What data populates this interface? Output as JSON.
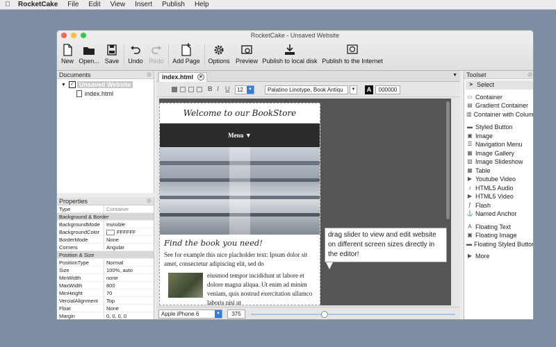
{
  "menubar": {
    "app": "RocketCake",
    "items": [
      "File",
      "Edit",
      "View",
      "Insert",
      "Publish",
      "Help"
    ]
  },
  "window": {
    "title": "RocketCake - Unsaved Website"
  },
  "toolbar": {
    "new": "New",
    "open": "Open...",
    "save": "Save",
    "undo": "Undo",
    "redo": "Redo",
    "add_page": "Add Page",
    "options": "Options",
    "preview": "Preview",
    "publish_local": "Publish to local disk",
    "publish_internet": "Publish to the Internet"
  },
  "documents": {
    "title": "Documents",
    "root": "Unsaved Website",
    "file": "index.html"
  },
  "properties": {
    "title": "Properties",
    "header": {
      "k": "Type",
      "v": "Container"
    },
    "rows": [
      {
        "k": "Background & Border",
        "v": "",
        "group": true
      },
      {
        "k": "BackgroundMode",
        "v": "Invisible"
      },
      {
        "k": "BackgroundColor",
        "v": "FFFFFF"
      },
      {
        "k": "BorderMode",
        "v": "None"
      },
      {
        "k": "Corners",
        "v": "Angular"
      },
      {
        "k": "Position & Size",
        "v": "",
        "group": true
      },
      {
        "k": "PositionType",
        "v": "Normal"
      },
      {
        "k": "Size",
        "v": "100%, auto"
      },
      {
        "k": "MinWidth",
        "v": "none"
      },
      {
        "k": "MaxWidth",
        "v": "800"
      },
      {
        "k": "MinHeight",
        "v": "70"
      },
      {
        "k": "VercialAlignment",
        "v": "Top"
      },
      {
        "k": "Float",
        "v": "None"
      },
      {
        "k": "Margin",
        "v": "0, 0, 0, 0"
      }
    ]
  },
  "editor": {
    "tab": "index.html",
    "font_size": "12",
    "font_name": "Palatino Linotype, Book Antiqu",
    "color_label": "A",
    "color_value": "000000",
    "device": "Apple iPhone 6",
    "width_value": "375",
    "slider_fraction": 0.36
  },
  "page": {
    "heading": "Welcome to our BookStore",
    "menu": "Menu",
    "find_title": "Find the book you need!",
    "p1": "See for example this nice placholder text: Ipsum dolor sit amet, consectetur adipiscing elit, sed do",
    "p2": "eiusmod tempor incididunt ut labore et dolore magna aliqua. Ut enim ad minim veniam, quis nostrud exercitation ullamco laboris nisi ut"
  },
  "tooltip": {
    "text": "drag slider to view and edit website on different screen sizes directly in the editor!"
  },
  "toolset": {
    "title": "Toolset",
    "select": "Select",
    "items": [
      "Container",
      "Gradient Container",
      "Container with Column"
    ],
    "items2": [
      "Styled Button",
      "Image",
      "Navigation Menu",
      "Image Gallery",
      "Image Slideshow",
      "Table",
      "Youtube Video",
      "HTML5 Audio",
      "HTML5 Video",
      "Flash",
      "Named Anchor"
    ],
    "items3": [
      "Floating Text",
      "Floating Image",
      "Floating Styled Button"
    ],
    "more": "More"
  },
  "colors": {
    "desktop": "#7d8da4",
    "selection": "#2f6fd6",
    "dark_nav": "#2b2b2b"
  }
}
